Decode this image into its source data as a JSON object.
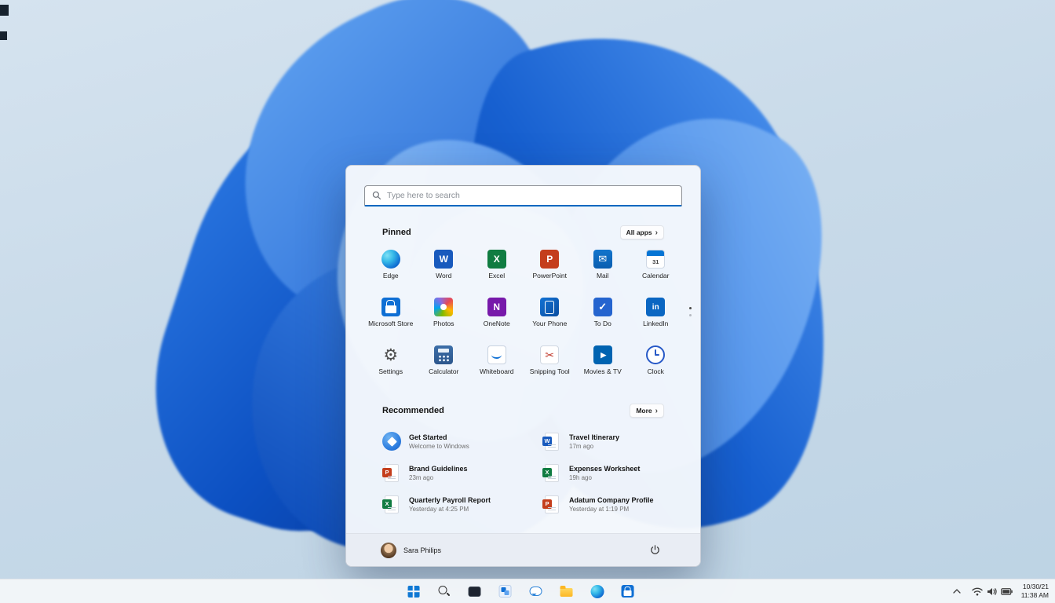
{
  "colors": {
    "accent": "#0067c0",
    "bloom_blue": "#0c50c2",
    "taskbar_bg": "#f3f6f9"
  },
  "icons": {
    "search": "magnifier glyph",
    "power": "power arc glyph",
    "all_apps_chevron": "›",
    "wifi": "signal arcs",
    "volume": "speaker",
    "battery": "battery outline",
    "hidden_icons": "chevron-up"
  },
  "start_menu": {
    "search": {
      "placeholder": "Type here to search"
    },
    "pinned": {
      "title": "Pinned",
      "all_apps_label": "All apps",
      "apps": [
        {
          "label": "Edge",
          "icon": "edge"
        },
        {
          "label": "Word",
          "icon": "word"
        },
        {
          "label": "Excel",
          "icon": "excel"
        },
        {
          "label": "PowerPoint",
          "icon": "powerpoint"
        },
        {
          "label": "Mail",
          "icon": "mail"
        },
        {
          "label": "Calendar",
          "icon": "calendar"
        },
        {
          "label": "Microsoft Store",
          "icon": "microsoft-store"
        },
        {
          "label": "Photos",
          "icon": "photos"
        },
        {
          "label": "OneNote",
          "icon": "onenote"
        },
        {
          "label": "Your Phone",
          "icon": "your-phone"
        },
        {
          "label": "To Do",
          "icon": "to-do"
        },
        {
          "label": "LinkedIn",
          "icon": "linkedin"
        },
        {
          "label": "Settings",
          "icon": "settings"
        },
        {
          "label": "Calculator",
          "icon": "calculator"
        },
        {
          "label": "Whiteboard",
          "icon": "whiteboard"
        },
        {
          "label": "Snipping Tool",
          "icon": "snipping-tool"
        },
        {
          "label": "Movies & TV",
          "icon": "movies-tv"
        },
        {
          "label": "Clock",
          "icon": "clock"
        }
      ]
    },
    "recommended": {
      "title": "Recommended",
      "more_label": "More",
      "items": [
        {
          "title": "Get Started",
          "subtitle": "Welcome to Windows",
          "icon": "get-started"
        },
        {
          "title": "Travel Itinerary",
          "subtitle": "17m ago",
          "icon": "word-doc"
        },
        {
          "title": "Brand Guidelines",
          "subtitle": "23m ago",
          "icon": "powerpoint-doc"
        },
        {
          "title": "Expenses Worksheet",
          "subtitle": "19h ago",
          "icon": "excel-doc"
        },
        {
          "title": "Quarterly Payroll Report",
          "subtitle": "Yesterday at 4:25 PM",
          "icon": "excel-doc"
        },
        {
          "title": "Adatum Company Profile",
          "subtitle": "Yesterday at 1:19 PM",
          "icon": "powerpoint-doc"
        }
      ]
    },
    "user": {
      "name": "Sara Philips"
    }
  },
  "taskbar": {
    "icons": [
      "start",
      "search",
      "task-view",
      "widgets",
      "chat",
      "file-explorer",
      "edge",
      "microsoft-store"
    ],
    "tray": {
      "date": "10/30/21",
      "time": "11:38 AM"
    }
  }
}
